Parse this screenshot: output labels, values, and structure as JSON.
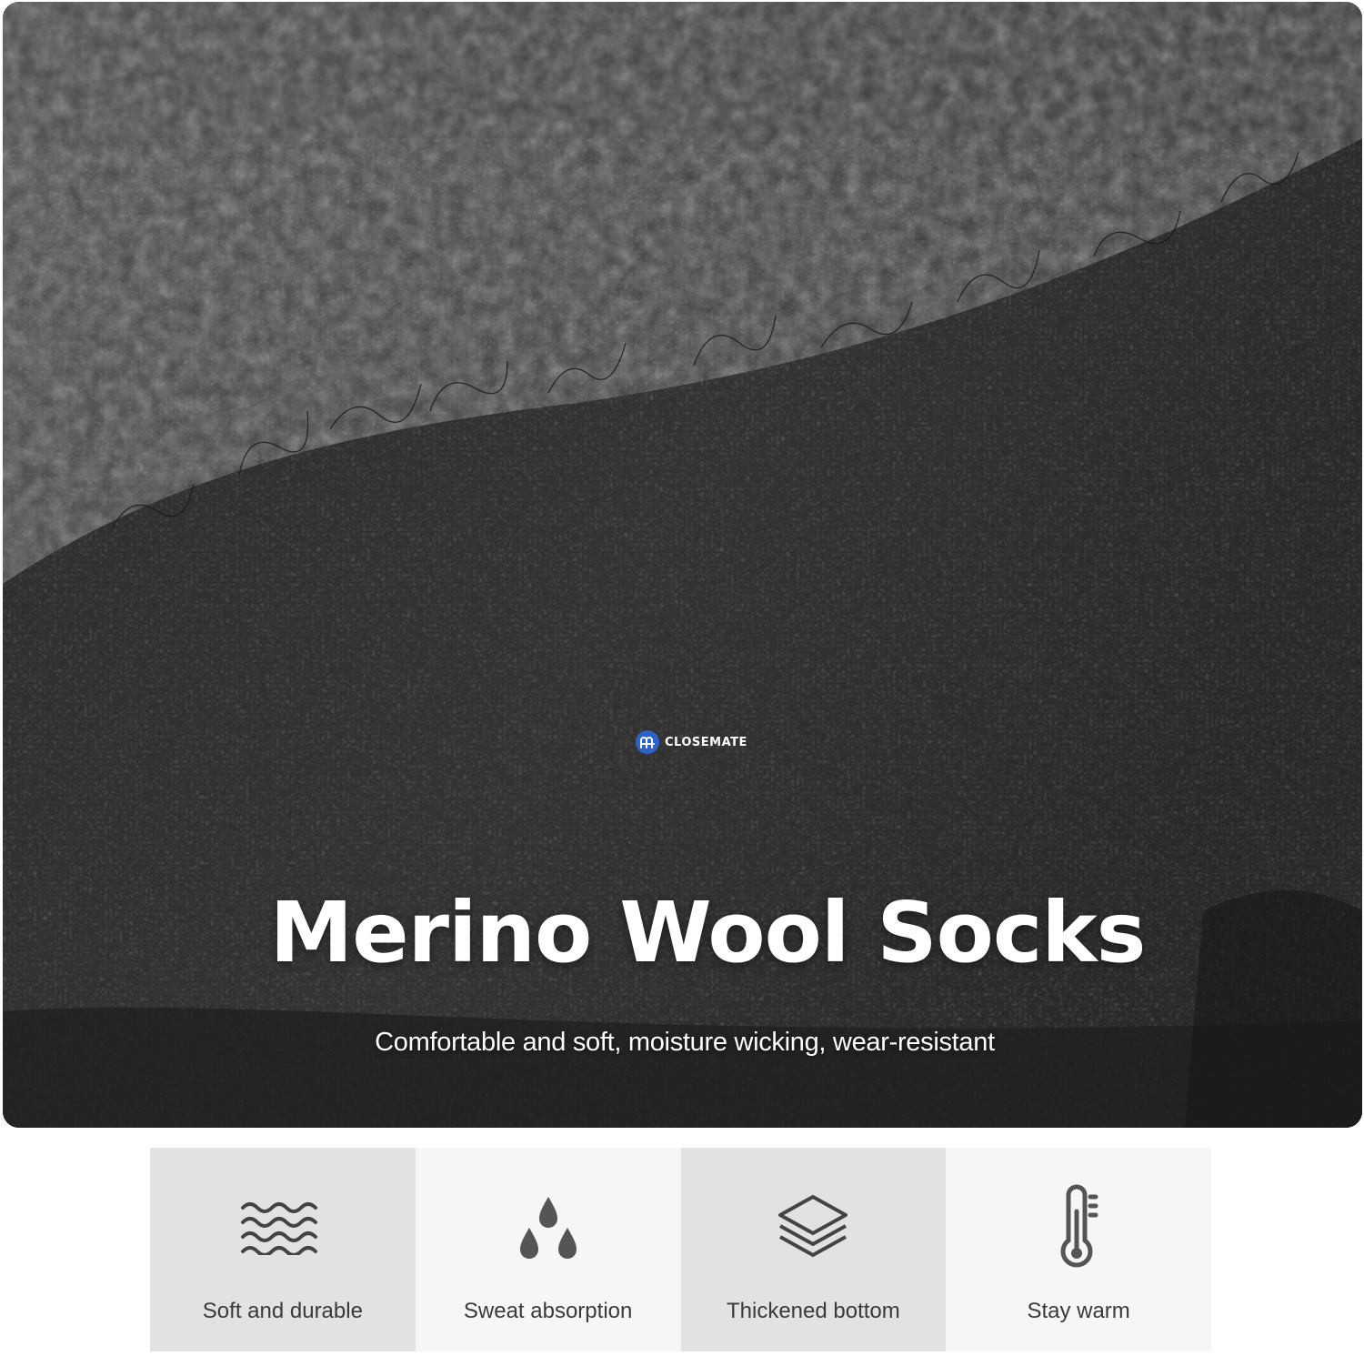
{
  "hero": {
    "brand_name": "CLOSEMATE",
    "brand_logo_icon": "closemate-logo-icon",
    "title": "Merino Wool Socks",
    "subtitle": "Comfortable and soft, moisture wicking, wear-resistant"
  },
  "features": [
    {
      "icon": "waves-icon",
      "label": "Soft and durable"
    },
    {
      "icon": "water-drops-icon",
      "label": "Sweat absorption"
    },
    {
      "icon": "layers-icon",
      "label": "Thickened bottom"
    },
    {
      "icon": "thermometer-icon",
      "label": "Stay warm"
    }
  ],
  "colors": {
    "brand_blue": "#2c63c8",
    "wool_dark": "#2a2a2a",
    "feature_gray": "#e2e2e2",
    "feature_light": "#f6f6f6",
    "icon_gray": "#555555"
  }
}
